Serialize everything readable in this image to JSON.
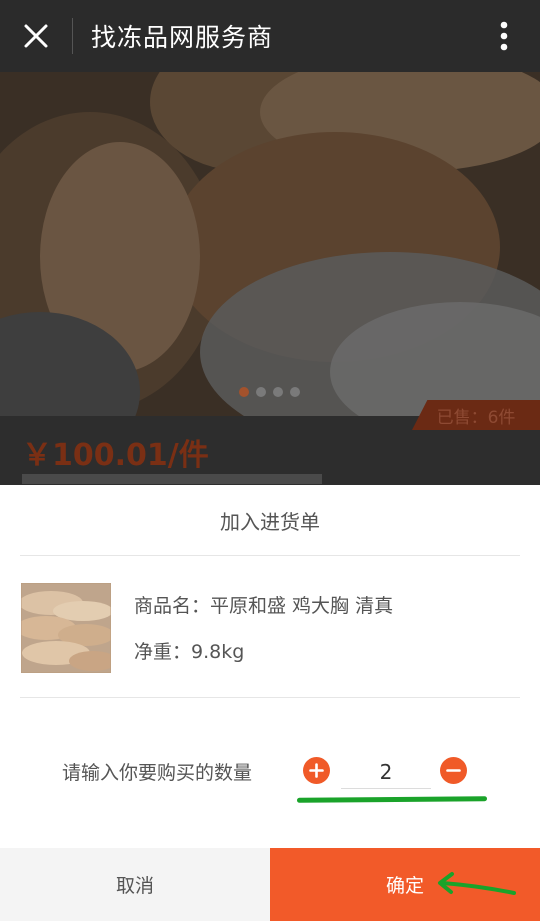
{
  "header": {
    "title": "找冻品网服务商",
    "close_icon": "close-icon",
    "more_icon": "more-vertical-icon"
  },
  "product_page": {
    "sold": "已售：6件",
    "price": "￥100.01/件",
    "carousel": {
      "count": 4,
      "active": 0
    }
  },
  "dialog": {
    "title": "加入进货单",
    "product_name": "商品名：平原和盛 鸡大胸 清真",
    "net_weight": "净重：9.8kg",
    "quantity_label": "请输入你要购买的数量",
    "quantity_value": "2",
    "cancel_label": "取消",
    "confirm_label": "确定"
  },
  "colors": {
    "accent": "#f25a29",
    "annotation": "#1aa32a",
    "topbar": "#2b2b2b"
  }
}
